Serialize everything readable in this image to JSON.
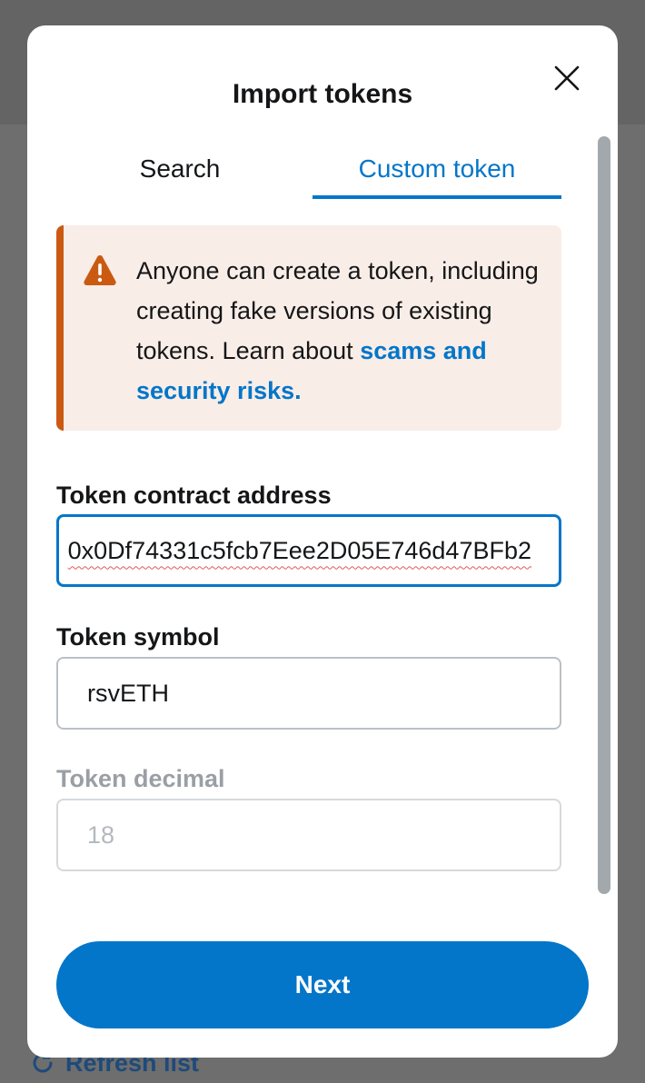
{
  "background": {
    "refresh_label": "Refresh list"
  },
  "modal": {
    "title": "Import tokens",
    "close_icon": "close-icon"
  },
  "tabs": [
    {
      "label": "Search",
      "active": false
    },
    {
      "label": "Custom token",
      "active": true
    }
  ],
  "warning": {
    "icon": "warning-triangle-icon",
    "text": "Anyone can create a token, including creating fake versions of existing tokens. Learn about ",
    "link": "scams and security risks."
  },
  "form": {
    "address_label": "Token contract address",
    "address_value": "0x0Df74331c5fcb7Eee2D05E746d47BFb2",
    "symbol_label": "Token symbol",
    "symbol_value": "rsvETH",
    "decimal_label": "Token decimal",
    "decimal_placeholder": "18"
  },
  "actions": {
    "next_label": "Next"
  },
  "colors": {
    "accent": "#0376c9",
    "warning_bar": "#ca5a12",
    "warning_bg": "#f9ede7"
  }
}
